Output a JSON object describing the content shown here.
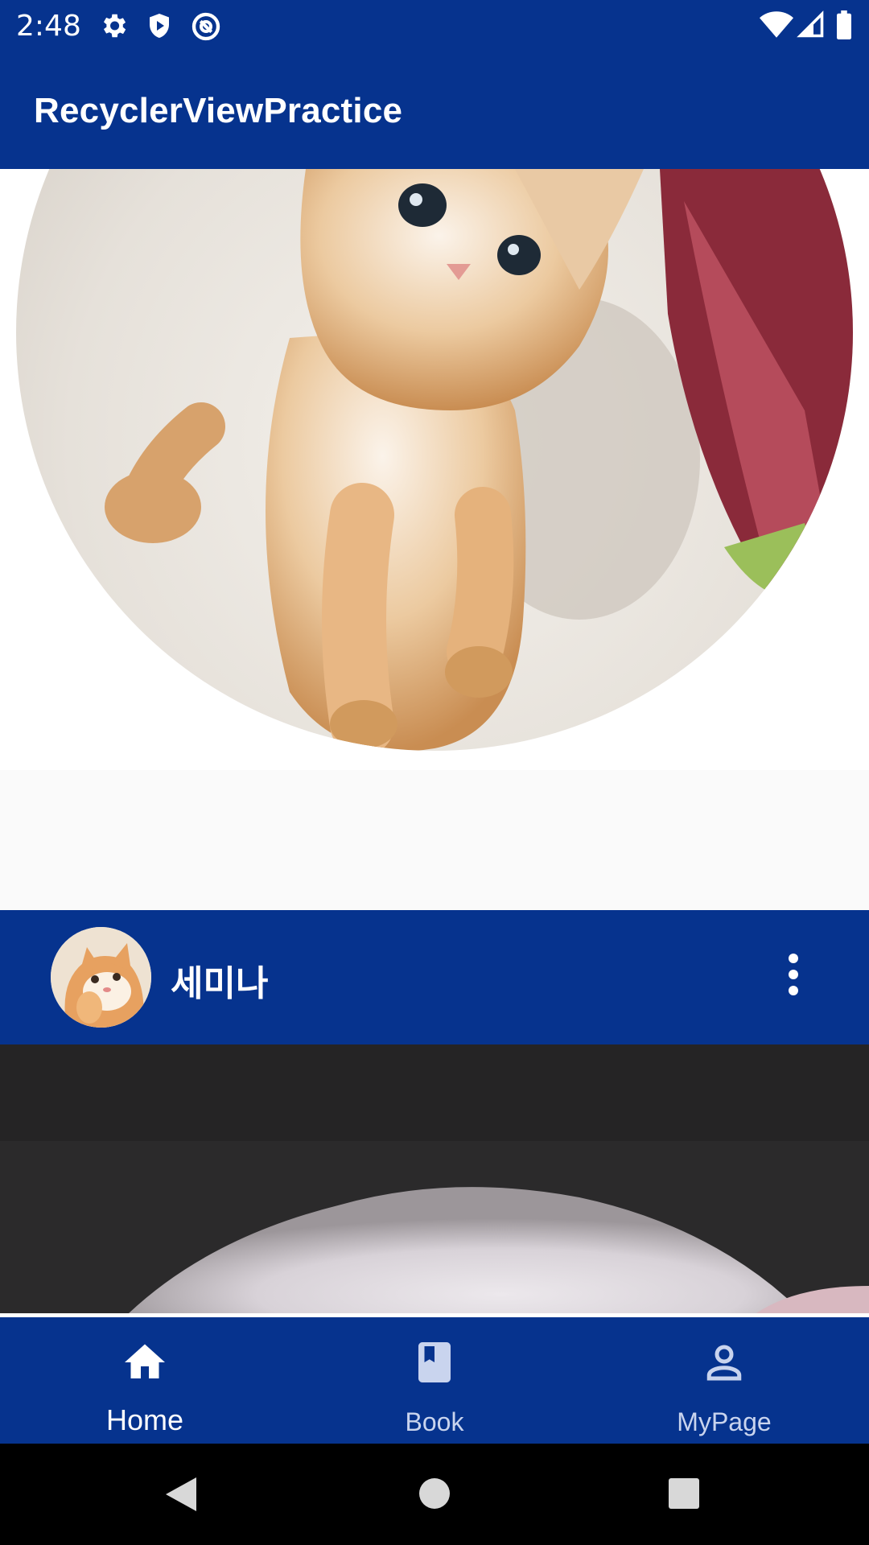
{
  "status_bar": {
    "time": "2:48",
    "icons": [
      "settings-icon",
      "shield-play-icon",
      "at-sign-icon",
      "wifi-icon",
      "cell-signal-icon",
      "battery-icon"
    ]
  },
  "app_bar": {
    "title": "RecyclerViewPractice"
  },
  "feed": {
    "posts": [
      {
        "image": "cat-photo-orange-kitten"
      },
      {
        "author": "세미나",
        "avatar": "cat-avatar",
        "menu_icon": "more-vert-icon",
        "image": "cat-photo-white"
      }
    ]
  },
  "bottom_nav": {
    "items": [
      {
        "label": "Home",
        "icon": "home-icon",
        "active": true
      },
      {
        "label": "Book",
        "icon": "book-icon",
        "active": false
      },
      {
        "label": "MyPage",
        "icon": "person-icon",
        "active": false
      }
    ]
  },
  "system_nav": {
    "buttons": [
      "back-icon",
      "home-circle-icon",
      "recents-icon"
    ]
  },
  "colors": {
    "primary": "#06338e",
    "on_primary": "#ffffff",
    "inactive_nav": "#c9d4ee"
  }
}
